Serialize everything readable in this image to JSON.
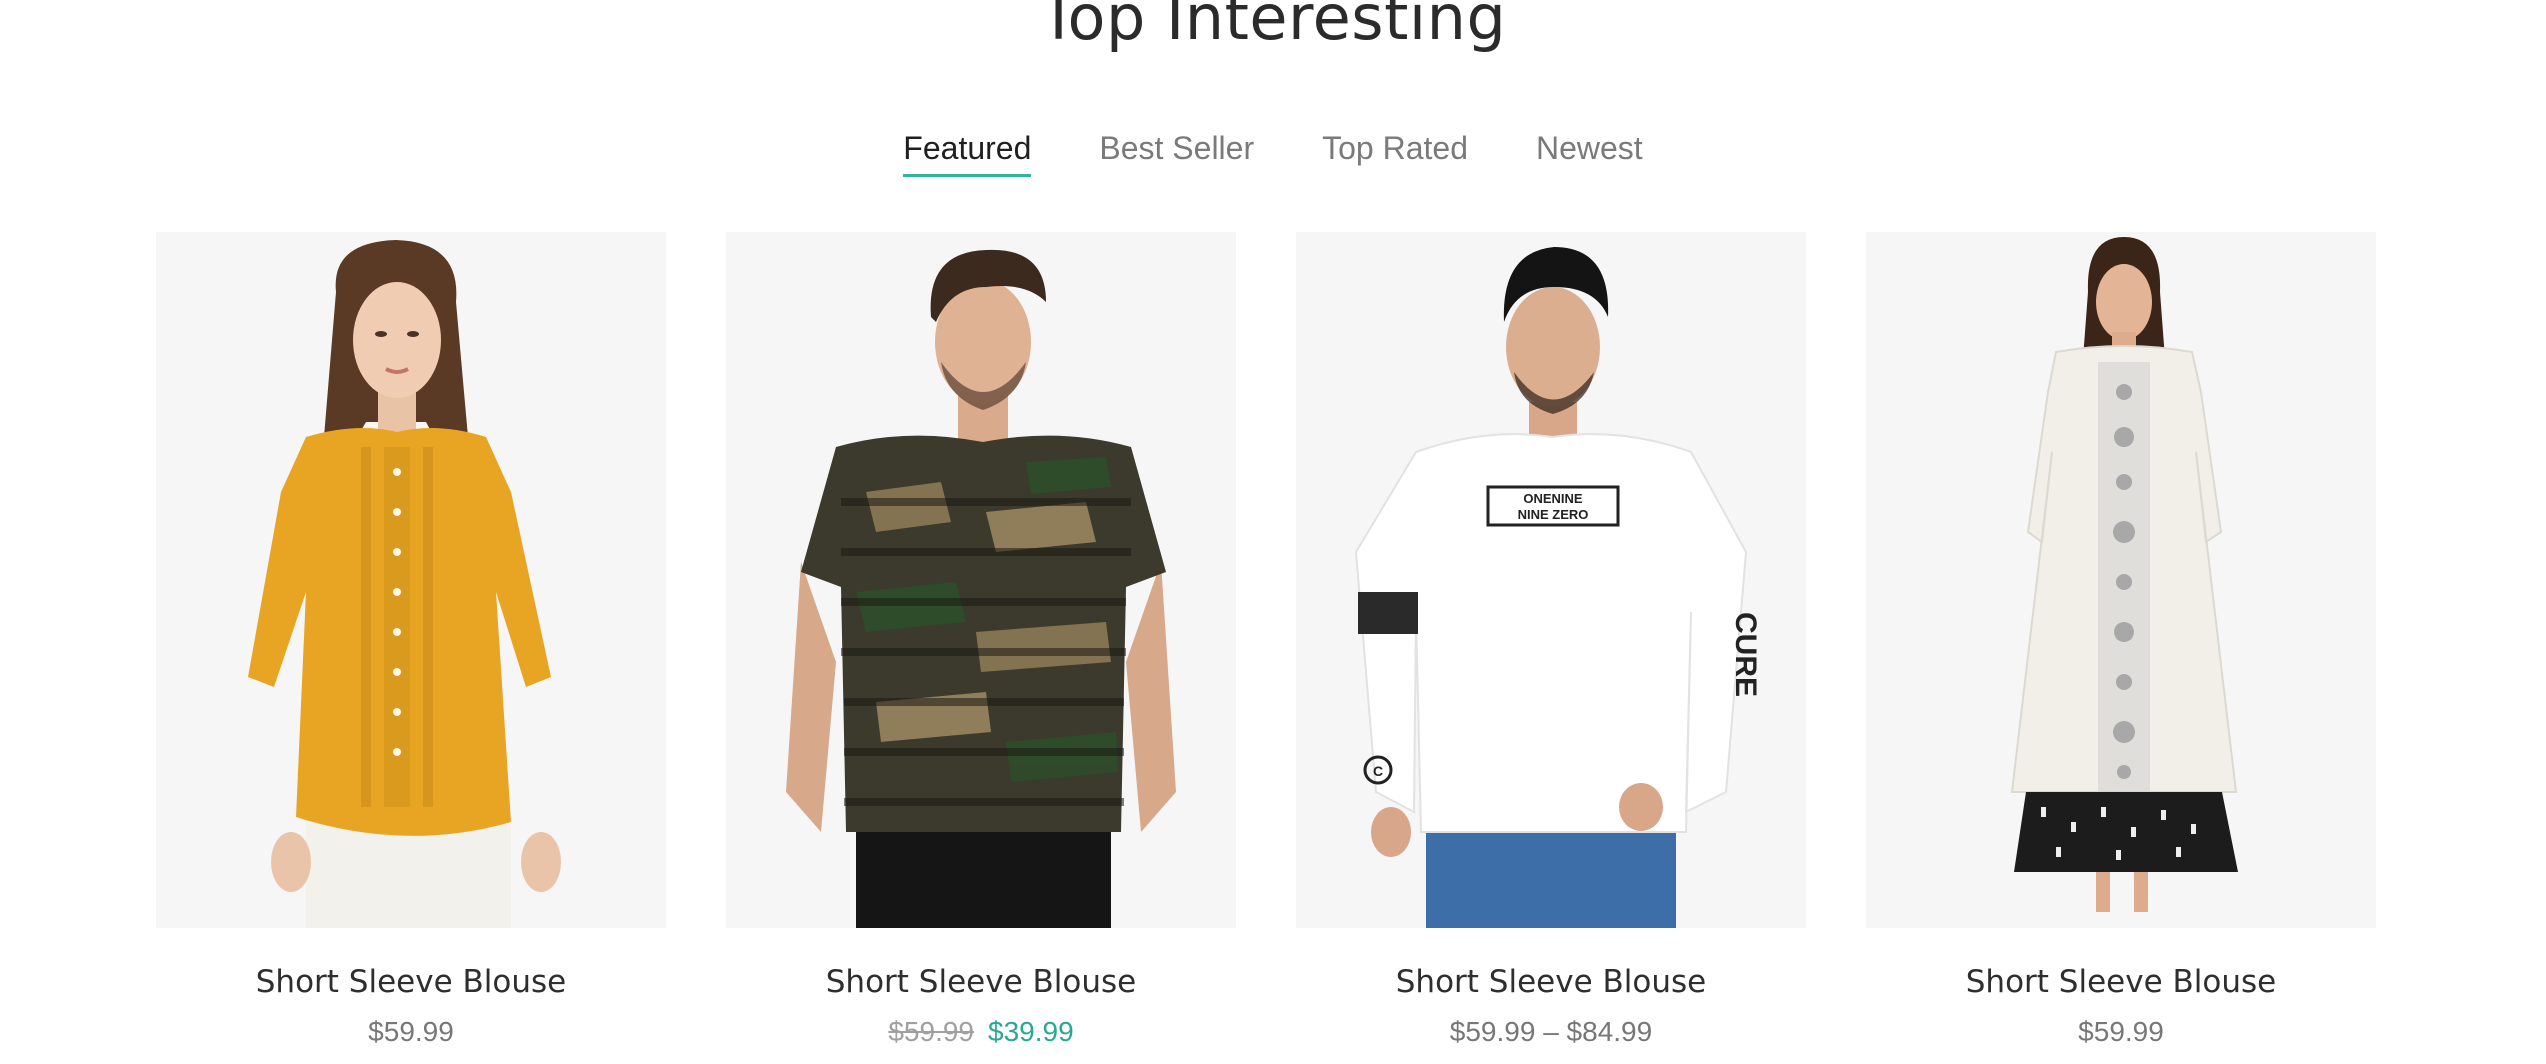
{
  "section": {
    "title": "Top Interesting"
  },
  "tabs": [
    {
      "label": "Featured",
      "active": true
    },
    {
      "label": "Best Seller",
      "active": false
    },
    {
      "label": "Top Rated",
      "active": false
    },
    {
      "label": "Newest",
      "active": false
    }
  ],
  "products": [
    {
      "name": "Short Sleeve Blouse",
      "price": "$59.99",
      "image": "woman-in-mustard-blouse",
      "shirt_color": "#e8a524",
      "shirt_print": ""
    },
    {
      "name": "Short Sleeve Blouse",
      "old_price": "$59.99",
      "sale_price": "$39.99",
      "image": "man-in-camo-tshirt",
      "shirt_color": "#3b3a2c",
      "shirt_print": ""
    },
    {
      "name": "Short Sleeve Blouse",
      "price": "$59.99 – $84.99",
      "image": "man-in-white-longsleeve",
      "shirt_color": "#ffffff",
      "shirt_print": "ONENINE NINE ZERO"
    },
    {
      "name": "Short Sleeve Blouse",
      "price": "$59.99",
      "image": "woman-in-white-kurta",
      "shirt_color": "#f1efe8",
      "shirt_print": ""
    }
  ],
  "colors": {
    "accent": "#2fb59a",
    "sale": "#2aa894",
    "card_bg": "#f6f6f6"
  }
}
